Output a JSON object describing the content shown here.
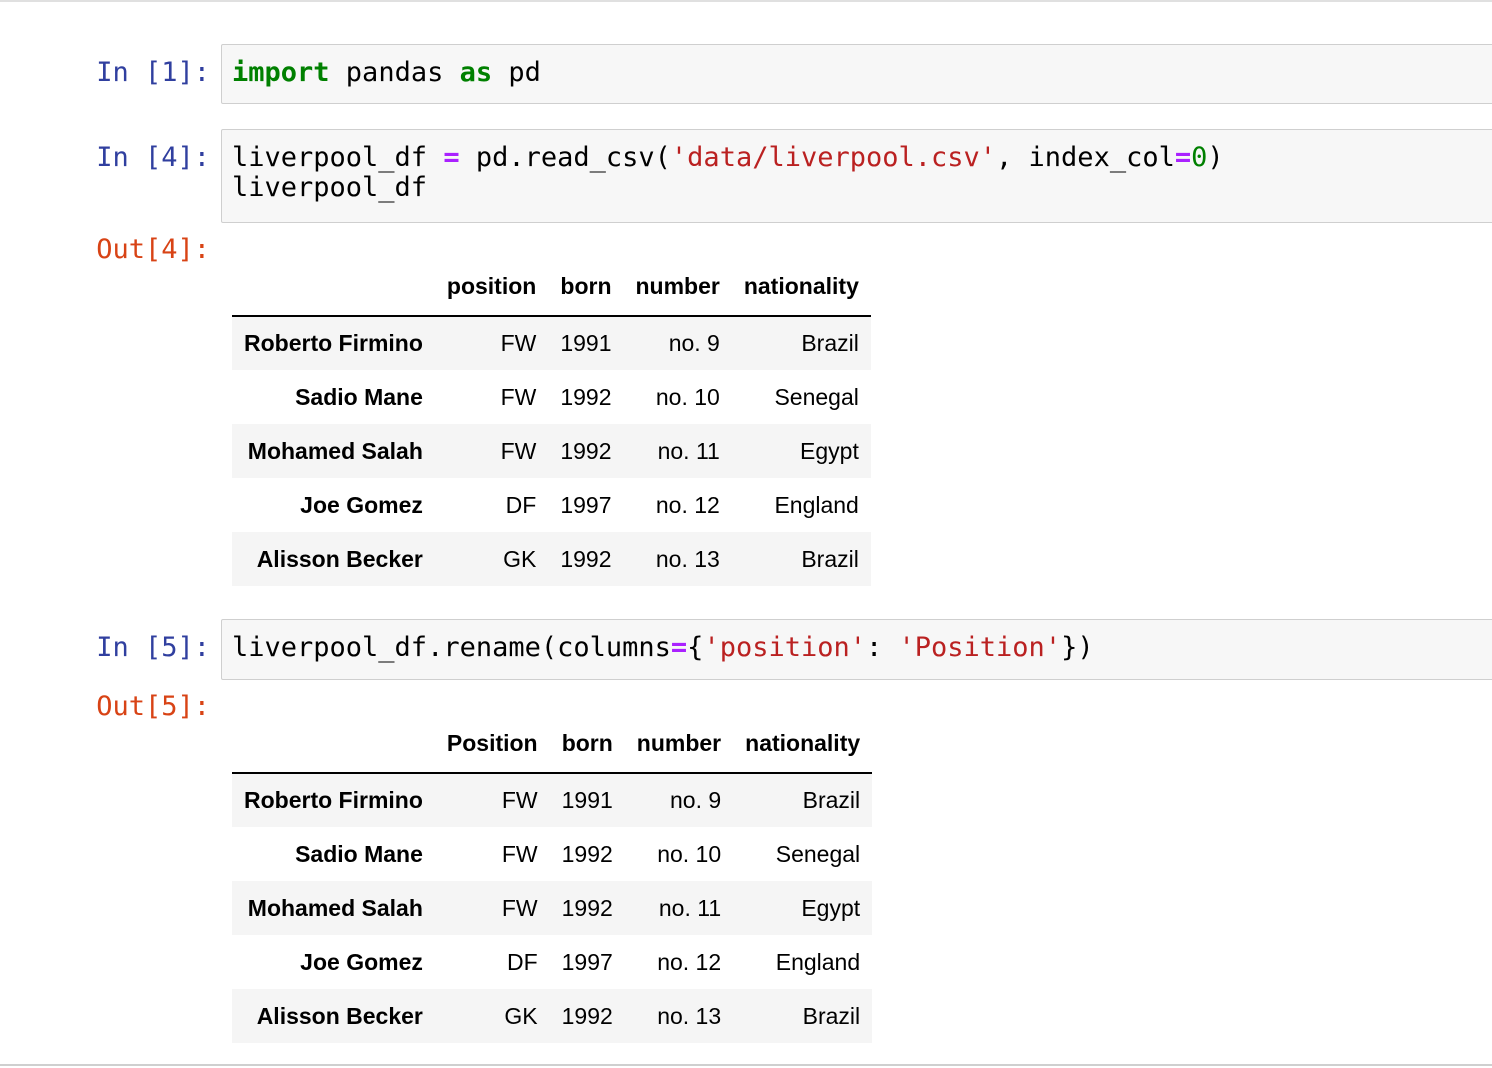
{
  "cells": [
    {
      "prompt": "In [1]:",
      "code": [
        [
          {
            "t": "import",
            "c": "kw"
          },
          {
            "t": " pandas ",
            "c": ""
          },
          {
            "t": "as",
            "c": "kw"
          },
          {
            "t": " pd",
            "c": ""
          }
        ]
      ]
    },
    {
      "prompt": "In [4]:",
      "code": [
        [
          {
            "t": "liverpool_df ",
            "c": ""
          },
          {
            "t": "=",
            "c": "op"
          },
          {
            "t": " pd.read_csv(",
            "c": ""
          },
          {
            "t": "'data/liverpool.csv'",
            "c": "str"
          },
          {
            "t": ", index_col",
            "c": ""
          },
          {
            "t": "=",
            "c": "op"
          },
          {
            "t": "0",
            "c": "num"
          },
          {
            "t": ")",
            "c": ""
          }
        ],
        [
          {
            "t": "liverpool_df",
            "c": ""
          }
        ]
      ],
      "out_prompt": "Out[4]:",
      "table": {
        "columns": [
          "position",
          "born",
          "number",
          "nationality"
        ],
        "rows": [
          {
            "index": "Roberto Firmino",
            "cells": [
              "FW",
              "1991",
              "no. 9",
              "Brazil"
            ]
          },
          {
            "index": "Sadio Mane",
            "cells": [
              "FW",
              "1992",
              "no. 10",
              "Senegal"
            ]
          },
          {
            "index": "Mohamed Salah",
            "cells": [
              "FW",
              "1992",
              "no. 11",
              "Egypt"
            ]
          },
          {
            "index": "Joe Gomez",
            "cells": [
              "DF",
              "1997",
              "no. 12",
              "England"
            ]
          },
          {
            "index": "Alisson Becker",
            "cells": [
              "GK",
              "1992",
              "no. 13",
              "Brazil"
            ]
          }
        ]
      }
    },
    {
      "prompt": "In [5]:",
      "code": [
        [
          {
            "t": "liverpool_df.rename(columns",
            "c": ""
          },
          {
            "t": "=",
            "c": "op"
          },
          {
            "t": "{",
            "c": ""
          },
          {
            "t": "'position'",
            "c": "str"
          },
          {
            "t": ": ",
            "c": ""
          },
          {
            "t": "'Position'",
            "c": "str"
          },
          {
            "t": "})",
            "c": ""
          }
        ]
      ],
      "out_prompt": "Out[5]:",
      "table": {
        "columns": [
          "Position",
          "born",
          "number",
          "nationality"
        ],
        "rows": [
          {
            "index": "Roberto Firmino",
            "cells": [
              "FW",
              "1991",
              "no. 9",
              "Brazil"
            ]
          },
          {
            "index": "Sadio Mane",
            "cells": [
              "FW",
              "1992",
              "no. 10",
              "Senegal"
            ]
          },
          {
            "index": "Mohamed Salah",
            "cells": [
              "FW",
              "1992",
              "no. 11",
              "Egypt"
            ]
          },
          {
            "index": "Joe Gomez",
            "cells": [
              "DF",
              "1997",
              "no. 12",
              "England"
            ]
          },
          {
            "index": "Alisson Becker",
            "cells": [
              "GK",
              "1992",
              "no. 13",
              "Brazil"
            ]
          }
        ]
      }
    }
  ]
}
